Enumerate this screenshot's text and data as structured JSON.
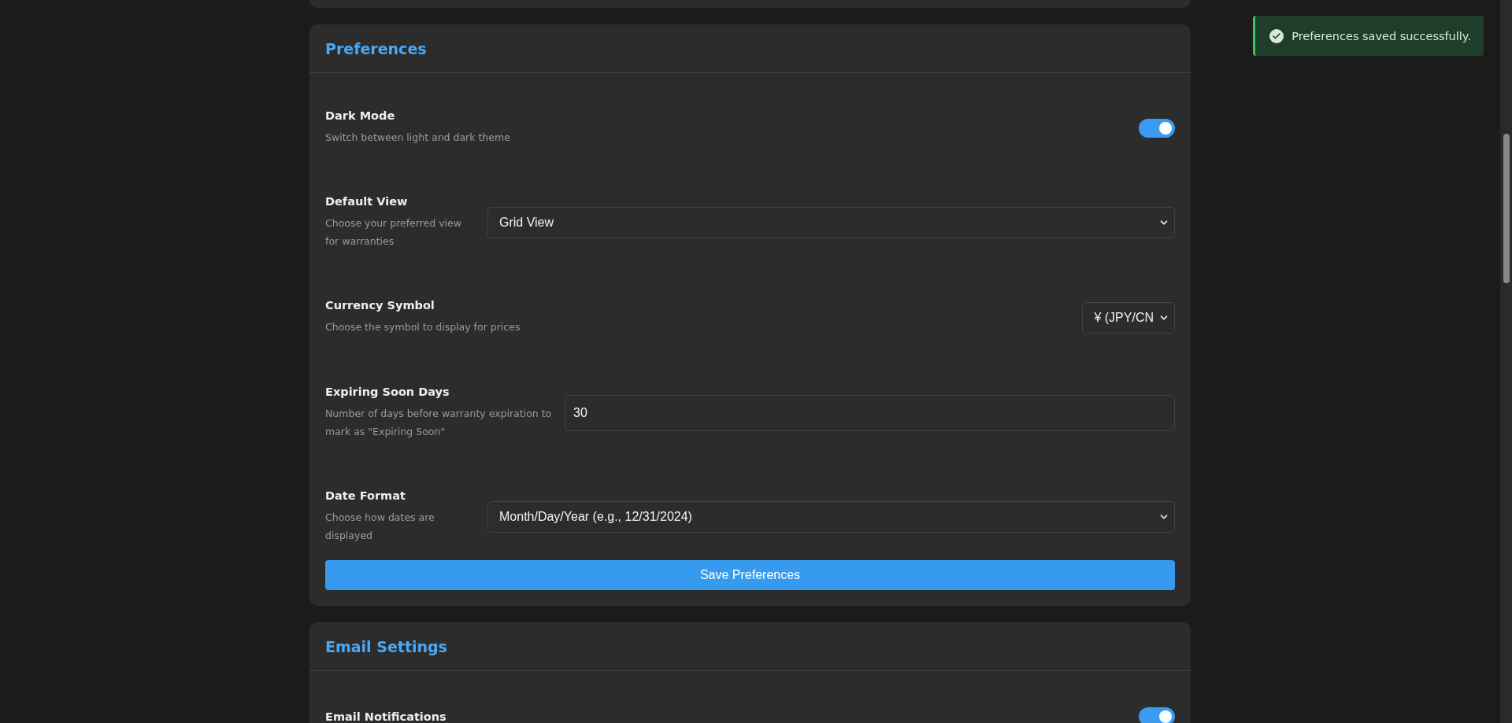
{
  "sections": [
    {
      "title": "Preferences",
      "settings": [
        {
          "kind": "toggle",
          "label": "Dark Mode",
          "description": "Switch between light and dark theme",
          "on": true
        },
        {
          "kind": "select",
          "label": "Default View",
          "description": "Choose your preferred view for warranties",
          "value": "Grid View",
          "wide": true
        },
        {
          "kind": "select",
          "label": "Currency Symbol",
          "description": "Choose the symbol to display for prices",
          "value": "¥ (JPY/CN",
          "wide": false
        },
        {
          "kind": "number",
          "label": "Expiring Soon Days",
          "description": "Number of days before warranty expiration to mark as \"Expiring Soon\"",
          "value": "30"
        },
        {
          "kind": "select",
          "label": "Date Format",
          "description": "Choose how dates are displayed",
          "value": "Month/Day/Year (e.g., 12/31/2024)",
          "wide": true
        }
      ],
      "button": "Save Preferences"
    },
    {
      "title": "Email Settings",
      "settings": [
        {
          "kind": "toggle",
          "label": "Email Notifications",
          "on": true
        }
      ]
    }
  ],
  "toast": {
    "message": "Preferences saved successfully."
  }
}
